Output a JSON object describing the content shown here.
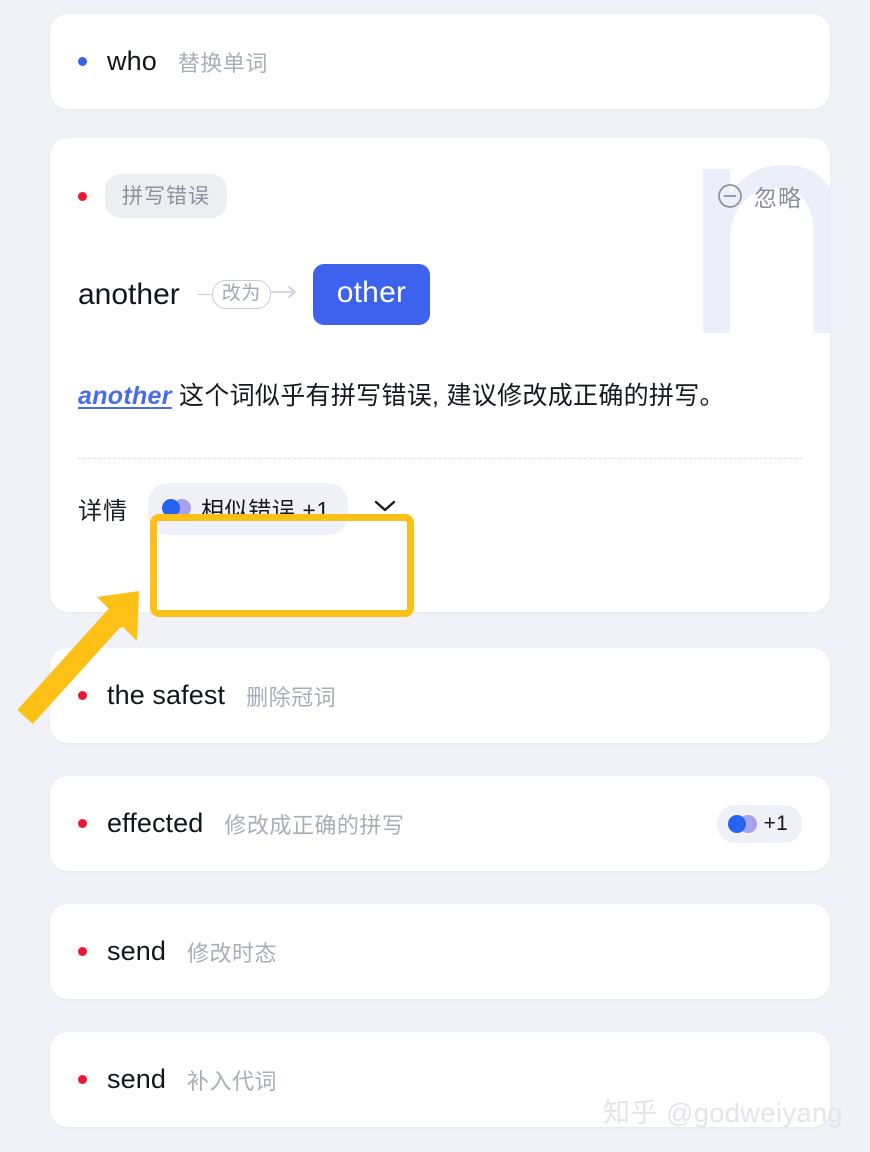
{
  "background_color": "#f1f2f7",
  "accent_color": "#3d62ed",
  "annotation_color": "#fcc016",
  "decoration_letter": "n",
  "rows": {
    "who": {
      "word": "who",
      "action": "替换单词",
      "bullet": "blue"
    },
    "the_safest": {
      "word": "the safest",
      "action": "删除冠词",
      "bullet": "red"
    },
    "effected": {
      "word": "effected",
      "action": "修改成正确的拼写",
      "bullet": "red",
      "badge": "+1"
    },
    "send_tense": {
      "word": "send",
      "action": "修改时态",
      "bullet": "red"
    },
    "send_pronoun": {
      "word": "send",
      "action": "补入代词",
      "bullet": "red"
    }
  },
  "detail": {
    "tag": "拼写错误",
    "ignore_label": "忽略",
    "ignore_icon": "minus-circle-icon",
    "original": "another",
    "connector_label": "改为",
    "replacement": "other",
    "explain_word": "another",
    "explain_text": " 这个词似乎有拼写错误, 建议修改成正确的拼写。",
    "footer_label": "详情",
    "chip_label": "相似错误 +1",
    "chip_icon": "overlapping-circles-icon",
    "expand_icon": "chevron-down-icon"
  },
  "watermark": "知乎 @godweiyang"
}
